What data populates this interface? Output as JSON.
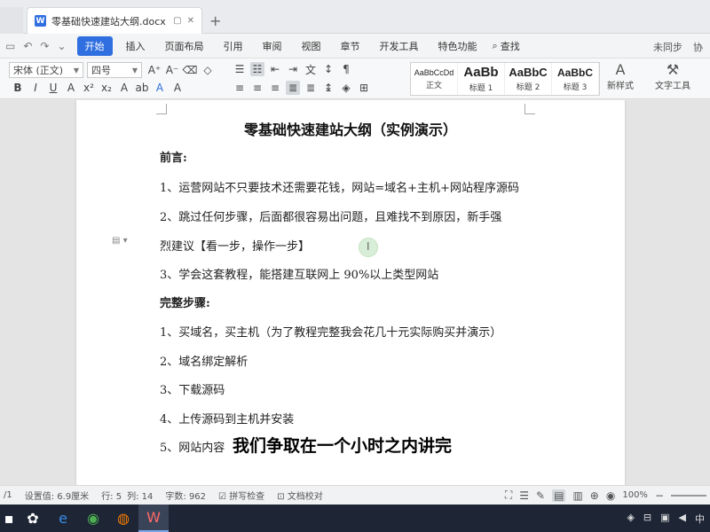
{
  "window": {
    "tab_title": "零基础快速建站大纲.docx",
    "tab_icon": "W"
  },
  "menu": {
    "items": [
      "开始",
      "插入",
      "页面布局",
      "引用",
      "审阅",
      "视图",
      "章节",
      "开发工具",
      "特色功能"
    ],
    "search_label": "查找",
    "right": [
      "未同步",
      "协"
    ]
  },
  "ribbon": {
    "font_name": "宋体 (正文)",
    "font_size": "四号",
    "styles": [
      {
        "preview": "AaBbCcDd",
        "name": "正文"
      },
      {
        "preview": "AaBb",
        "name": "标题 1"
      },
      {
        "preview": "AaBbC",
        "name": "标题 2"
      },
      {
        "preview": "AaBbC",
        "name": "标题 3"
      }
    ],
    "new_style_label": "新样式",
    "text_tool_label": "文字工具"
  },
  "document": {
    "title": "零基础快速建站大纲（实例演示）",
    "paragraphs": [
      {
        "text": "前言:",
        "bold": true
      },
      {
        "text": "1、运营网站不只要技术还需要花钱，网站=域名+主机+网站程序源码",
        "bold": false
      },
      {
        "text": "2、跳过任何步骤，后面都很容易出问题，且难找不到原因，新手强",
        "bold": false
      },
      {
        "text": "烈建议【看一步，操作一步】",
        "bold": false
      },
      {
        "text": "3、学会这套教程，能搭建互联网上 90%以上类型网站",
        "bold": false
      },
      {
        "text": "完整步骤:",
        "bold": true
      },
      {
        "text": "1、买域名，买主机（为了教程完整我会花几十元实际购买并演示）",
        "bold": false
      },
      {
        "text": "2、域名绑定解析",
        "bold": false
      },
      {
        "text": "3、下载源码",
        "bold": false
      },
      {
        "text": "4、上传源码到主机并安装",
        "bold": false
      },
      {
        "text": "5、网站内容",
        "bold": false
      }
    ],
    "caption": "我们争取在一个小时之内讲完"
  },
  "statusbar": {
    "page": "/1",
    "setting": "设置值: 6.9厘米",
    "row": "行: 5",
    "col": "列: 14",
    "word_count": "字数: 962",
    "spell_check": "拼写检查",
    "doc_check": "文档校对",
    "zoom": "100%"
  },
  "taskbar": {
    "tray_text": "中"
  },
  "colors": {
    "accent": "#2f6fe0",
    "taskbar": "#1e2636"
  }
}
